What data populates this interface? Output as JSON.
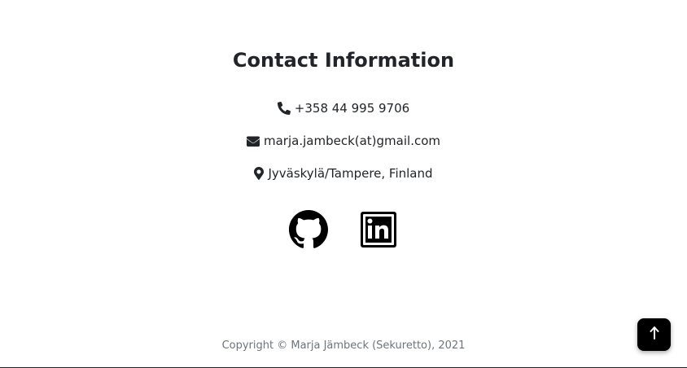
{
  "contact": {
    "title": "Contact Information",
    "phone": "+358 44 995 9706",
    "email": "marja.jambeck(at)gmail.com",
    "location": "Jyväskylä/Tampere, Finland"
  },
  "social": {
    "github_icon": "github-icon",
    "linkedin_icon": "linkedin-icon"
  },
  "footer": {
    "copyright": "Copyright © Marja Jämbeck (Sekuretto), 2021"
  },
  "scroll_top": {
    "label": "🠕",
    "icon": "arrow-up-icon"
  },
  "colors": {
    "text": "#212529",
    "muted": "#6c757d",
    "button_bg": "#000000"
  }
}
